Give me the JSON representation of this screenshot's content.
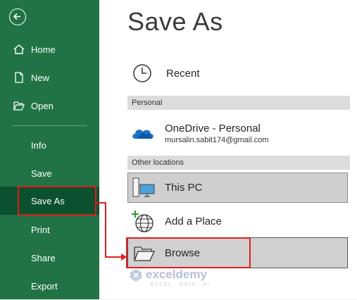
{
  "sidebar": {
    "items": [
      {
        "label": "Home",
        "icon": "home-icon"
      },
      {
        "label": "New",
        "icon": "new-document-icon"
      },
      {
        "label": "Open",
        "icon": "folder-open-icon"
      },
      {
        "label": "Info"
      },
      {
        "label": "Save"
      },
      {
        "label": "Save As"
      },
      {
        "label": "Print"
      },
      {
        "label": "Share"
      },
      {
        "label": "Export"
      }
    ],
    "active": "Save As",
    "color": "#217346",
    "active_color": "#0b5130"
  },
  "main": {
    "title": "Save As",
    "recent_label": "Recent",
    "personal_section": "Personal",
    "onedrive": {
      "label": "OneDrive - Personal",
      "email": "mursalin.sabit174@gmail.com"
    },
    "other_section": "Other locations",
    "this_pc_label": "This PC",
    "add_place_label": "Add a Place",
    "browse_label": "Browse"
  },
  "watermark": {
    "name": "exceldemy",
    "tagline": "EXCEL · DATA · BI"
  },
  "highlight_color": "#e11d1d"
}
